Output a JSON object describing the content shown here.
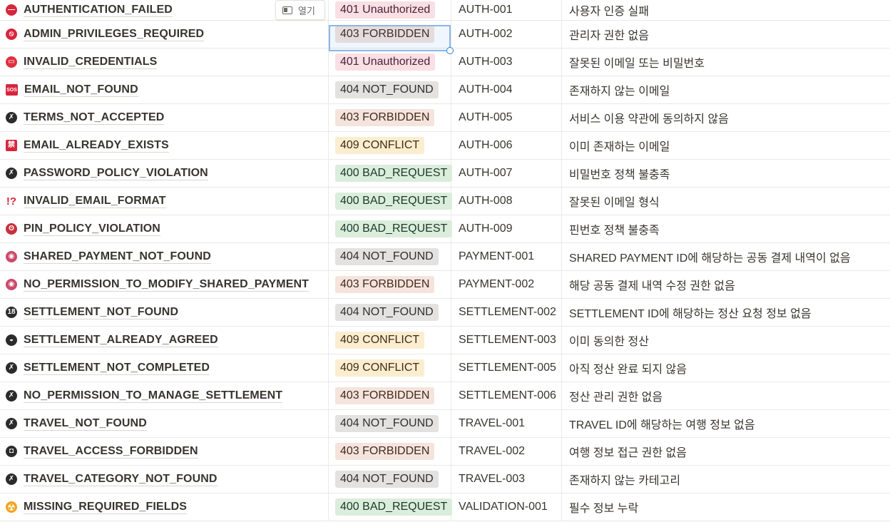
{
  "open_button_label": "열기",
  "status_colors": {
    "401": "#f9dfe6",
    "403": "#f4e4dc",
    "404": "#e3e2e0",
    "409": "#fbeecf",
    "400": "#dbeddb"
  },
  "rows": [
    {
      "icon": "no-entry-icon",
      "icon_color": "#d7263d",
      "icon_glyph": "—",
      "name": "AUTHENTICATION_FAILED",
      "status": "401 Unauthorized",
      "status_key": "401",
      "code": "AUTH-001",
      "desc": "사용자 인증 실패"
    },
    {
      "icon": "prohibited-icon",
      "icon_color": "#d7263d",
      "icon_glyph": "⦸",
      "name": "ADMIN_PRIVILEGES_REQUIRED",
      "status": "403 FORBIDDEN",
      "status_key": "403",
      "code": "AUTH-002",
      "desc": "관리자 권한 없음"
    },
    {
      "icon": "calendar-icon",
      "icon_color": "#e0303f",
      "icon_glyph": "▭",
      "name": "INVALID_CREDENTIALS",
      "status": "401 Unauthorized",
      "status_key": "401",
      "code": "AUTH-003",
      "desc": "잘못된 이메일 또는 비밀번호"
    },
    {
      "icon": "sos-icon",
      "icon_color": "#d7263d",
      "icon_glyph": "SOS",
      "name": "EMAIL_NOT_FOUND",
      "status": "404 NOT_FOUND",
      "status_key": "404",
      "code": "AUTH-004",
      "desc": "존재하지 않는 이메일"
    },
    {
      "icon": "no-pedestrians-icon",
      "icon_color": "#2b2b2b",
      "icon_glyph": "✗",
      "name": "TERMS_NOT_ACCEPTED",
      "status": "403 FORBIDDEN",
      "status_key": "403",
      "code": "AUTH-005",
      "desc": "서비스 이용 약관에 동의하지 않음"
    },
    {
      "icon": "prohibited-button-icon",
      "icon_color": "#d7263d",
      "icon_glyph": "禁",
      "name": "EMAIL_ALREADY_EXISTS",
      "status": "409 CONFLICT",
      "status_key": "409",
      "code": "AUTH-006",
      "desc": "이미 존재하는 이메일"
    },
    {
      "icon": "no-pedestrians-icon",
      "icon_color": "#2b2b2b",
      "icon_glyph": "✗",
      "name": "PASSWORD_POLICY_VIOLATION",
      "status": "400 BAD_REQUEST",
      "status_key": "400",
      "code": "AUTH-007",
      "desc": "비밀번호 정책 불충족"
    },
    {
      "icon": "exclamation-question-icon",
      "icon_color": "#d7263d",
      "icon_glyph": "!?",
      "name": "INVALID_EMAIL_FORMAT",
      "status": "400 BAD_REQUEST",
      "status_key": "400",
      "code": "AUTH-008",
      "desc": "잘못된 이메일 형식"
    },
    {
      "icon": "angry-face-icon",
      "icon_color": "#c9303a",
      "icon_glyph": "ʘ",
      "name": "PIN_POLICY_VIOLATION",
      "status": "400 BAD_REQUEST",
      "status_key": "400",
      "code": "AUTH-009",
      "desc": "핀번호 정책 불충족"
    },
    {
      "icon": "troll-icon",
      "icon_color": "#c94a6a",
      "icon_glyph": "◉",
      "name": "SHARED_PAYMENT_NOT_FOUND",
      "status": "404 NOT_FOUND",
      "status_key": "404",
      "code": "PAYMENT-001",
      "desc": "SHARED PAYMENT ID에 해당하는 공동 결제 내역이 없음"
    },
    {
      "icon": "troll-icon",
      "icon_color": "#c94a6a",
      "icon_glyph": "◉",
      "name": "NO_PERMISSION_TO_MODIFY_SHARED_PAYMENT",
      "status": "403 FORBIDDEN",
      "status_key": "403",
      "code": "PAYMENT-002",
      "desc": "해당 공동 결제 내역 수정 권한 없음"
    },
    {
      "icon": "no-one-under-eighteen-icon",
      "icon_color": "#2b2b2b",
      "icon_glyph": "18",
      "name": "SETTLEMENT_NOT_FOUND",
      "status": "404 NOT_FOUND",
      "status_key": "404",
      "code": "SETTLEMENT-002",
      "desc": "SETTLEMENT ID에 해당하는 정산 요청 정보 없음"
    },
    {
      "icon": "no-littering-icon",
      "icon_color": "#2b2b2b",
      "icon_glyph": "◒",
      "name": "SETTLEMENT_ALREADY_AGREED",
      "status": "409 CONFLICT",
      "status_key": "409",
      "code": "SETTLEMENT-003",
      "desc": "이미 동의한 정산"
    },
    {
      "icon": "no-pedestrians-icon",
      "icon_color": "#2b2b2b",
      "icon_glyph": "✗",
      "name": "SETTLEMENT_NOT_COMPLETED",
      "status": "409 CONFLICT",
      "status_key": "409",
      "code": "SETTLEMENT-005",
      "desc": "아직 정산 완료 되지 않음"
    },
    {
      "icon": "no-pedestrians-icon",
      "icon_color": "#2b2b2b",
      "icon_glyph": "✗",
      "name": "NO_PERMISSION_TO_MANAGE_SETTLEMENT",
      "status": "403 FORBIDDEN",
      "status_key": "403",
      "code": "SETTLEMENT-006",
      "desc": "정산 관리 권한 없음"
    },
    {
      "icon": "no-mobile-phones-icon",
      "icon_color": "#2b2b2b",
      "icon_glyph": "✗",
      "name": "TRAVEL_NOT_FOUND",
      "status": "404 NOT_FOUND",
      "status_key": "404",
      "code": "TRAVEL-001",
      "desc": "TRAVEL ID에 해당하는 여행 정보 없음"
    },
    {
      "icon": "no-entry-sign-icon",
      "icon_color": "#2b2b2b",
      "icon_glyph": "◘",
      "name": "TRAVEL_ACCESS_FORBIDDEN",
      "status": "403 FORBIDDEN",
      "status_key": "403",
      "code": "TRAVEL-002",
      "desc": "여행 정보 접근 권한 없음"
    },
    {
      "icon": "no-pedestrians-icon",
      "icon_color": "#2b2b2b",
      "icon_glyph": "✗",
      "name": "TRAVEL_CATEGORY_NOT_FOUND",
      "status": "404 NOT_FOUND",
      "status_key": "404",
      "code": "TRAVEL-003",
      "desc": "존재하지 않는 카테고리"
    },
    {
      "icon": "radioactive-icon",
      "icon_color": "#f2a31b",
      "icon_glyph": "☢",
      "name": "MISSING_REQUIRED_FIELDS",
      "status": "400 BAD_REQUEST",
      "status_key": "400",
      "code": "VALIDATION-001",
      "desc": "필수 정보 누락"
    }
  ]
}
